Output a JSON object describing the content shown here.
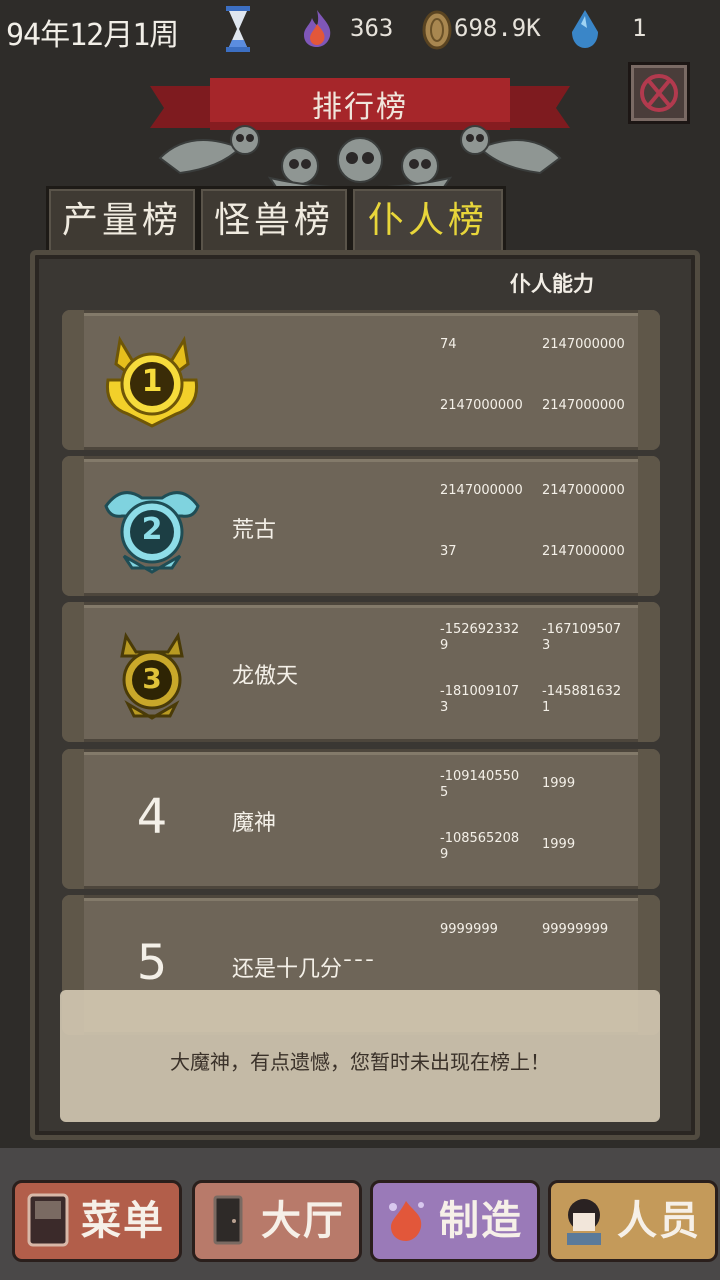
{
  "status": {
    "date": "94年12月1周",
    "fire": "363",
    "gold": "698.9K",
    "crystal": "1"
  },
  "title": "排行榜",
  "tabs": [
    "产量榜",
    "怪兽榜",
    "仆人榜"
  ],
  "active_tab": 2,
  "column_header": "仆人能力",
  "rows": [
    {
      "rank": "1",
      "name": "",
      "cells": [
        "74",
        "2147000000",
        "2147000000",
        "2147000000"
      ]
    },
    {
      "rank": "2",
      "name": "荒古",
      "cells": [
        "2147000000",
        "2147000000",
        "37",
        "2147000000"
      ]
    },
    {
      "rank": "3",
      "name": "龙傲天",
      "cells": [
        "-1526923329",
        "-1671095073",
        "-1810091073",
        "-1458816321"
      ]
    },
    {
      "rank": "4",
      "name": "魔神",
      "cells": [
        "-1091405505",
        "1999",
        "-1085652089",
        "1999"
      ]
    },
    {
      "rank": "5",
      "name": "还是十几分¯¯¯",
      "cells": [
        "9999999",
        "99999999",
        "",
        ""
      ]
    }
  ],
  "message": "大魔神，有点遗憾，您暂时未出现在榜上！",
  "nav": [
    "菜单",
    "大厅",
    "制造",
    "人员"
  ],
  "colors": {
    "active_tab": "#e8d63a",
    "banner": "#a6262a"
  }
}
